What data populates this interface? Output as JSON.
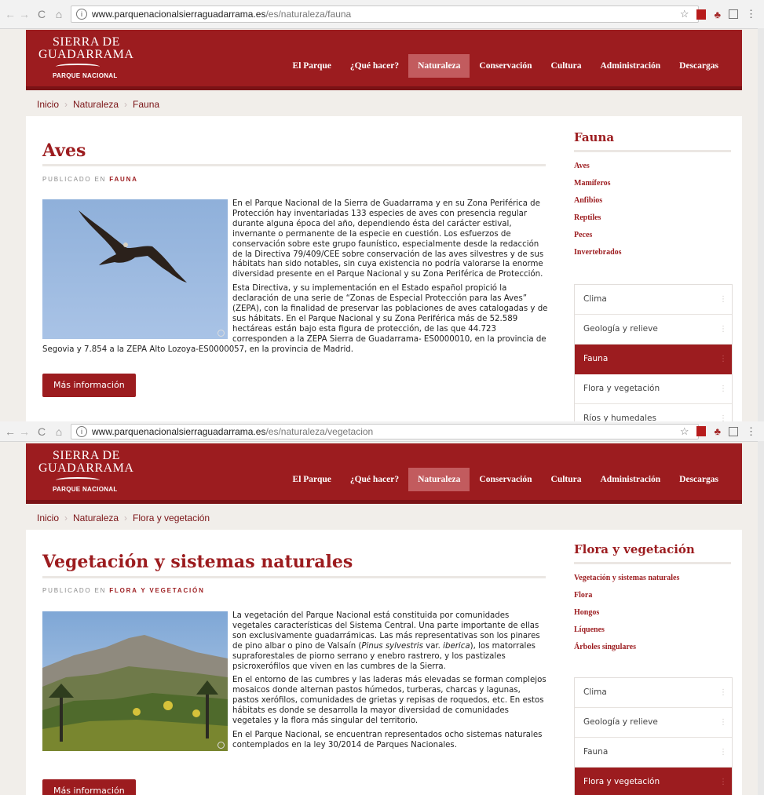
{
  "top": {
    "browser": {
      "url_domain": "www.parquenacionalsierraguadarrama.es",
      "url_path": "/es/naturaleza/fauna",
      "info_icon": "i"
    },
    "logo": {
      "line1": "SIERRA DE",
      "line2": "GUADARRAMA",
      "line3": "PARQUE NACIONAL"
    },
    "nav": [
      "El Parque",
      "¿Qué hacer?",
      "Naturaleza",
      "Conservación",
      "Cultura",
      "Administración",
      "Descargas"
    ],
    "nav_active": "Naturaleza",
    "breadcrumb": [
      "Inicio",
      "Naturaleza",
      "Fauna"
    ],
    "breadcrumb_sep": "›",
    "title": "Aves",
    "meta_prefix": "PUBLICADO EN",
    "meta_category": "FAUNA",
    "paragraphs": [
      "En el Parque Nacional de la Sierra de Guadarrama y en su Zona Periférica de Protección hay inventariadas 133 especies de aves con presencia regular durante alguna época del año, dependiendo ésta del carácter estival, invernante o permanente de la especie en cuestión. Los esfuerzos de conservación sobre este grupo faunístico, especialmente desde la redacción de la Directiva 79/409/CEE sobre conservación de las aves silvestres y de sus hábitats han sido notables, sin cuya existencia no podría valorarse la enorme diversidad presente en el Parque Nacional y su Zona Periférica de Protección.",
      "Esta Directiva, y su implementación en el Estado español propició la declaración de una serie de “Zonas de Especial Protección para las Aves” (ZEPA), con la finalidad de preservar las poblaciones de aves catalogadas y de sus hábitats. En el Parque Nacional y su Zona Periférica más de 52.589 hectáreas están bajo esta figura de protección, de las que 44.723 corresponden a la ZEPA Sierra de Guadarrama- ES0000010, en la provincia de Segovia y 7.854 a la ZEPA Alto Lozoya-ES0000057, en la provincia de Madrid."
    ],
    "more_button": "Más información",
    "sidebar_title": "Fauna",
    "sidebar_links": [
      "Aves",
      "Mamíferos",
      "Anfibios",
      "Reptiles",
      "Peces",
      "Invertebrados"
    ],
    "sidebar_menu": [
      "Clima",
      "Geología y relieve",
      "Fauna",
      "Flora y vegetación",
      "Ríos y humedales"
    ],
    "sidebar_menu_active": "Fauna"
  },
  "bottom": {
    "browser": {
      "url_domain": "www.parquenacionalsierraguadarrama.es",
      "url_path": "/es/naturaleza/vegetacion",
      "info_icon": "i"
    },
    "logo": {
      "line1": "SIERRA DE",
      "line2": "GUADARRAMA",
      "line3": "PARQUE NACIONAL"
    },
    "nav": [
      "El Parque",
      "¿Qué hacer?",
      "Naturaleza",
      "Conservación",
      "Cultura",
      "Administración",
      "Descargas"
    ],
    "nav_active": "Naturaleza",
    "breadcrumb": [
      "Inicio",
      "Naturaleza",
      "Flora y vegetación"
    ],
    "breadcrumb_sep": "›",
    "title": "Vegetación y sistemas naturales",
    "meta_prefix": "PUBLICADO EN",
    "meta_category": "FLORA Y VEGETACIÓN",
    "paragraphs_html": [
      "La vegetación del Parque Nacional está constituida por comunidades vegetales características del Sistema Central. Una parte importante de ellas son exclusivamente guadarrámicas. Las más representativas son los pinares de pino albar o pino de Valsaín (<i>Pinus sylvestris</i> var. <i>iberica</i>), los matorrales supraforestales de piorno serrano y enebro rastrero, y los pastizales psicroxerófilos que viven en las cumbres de la Sierra.",
      "En el entorno de las cumbres y las laderas más elevadas se forman complejos mosaicos donde alternan pastos húmedos, turberas, charcas y lagunas, pastos xerófilos, comunidades de grietas y repisas de roquedos, etc. En estos hábitats es donde se desarrolla la mayor diversidad de comunidades vegetales y la flora más singular del territorio.",
      "En el Parque Nacional, se encuentran representados ocho sistemas naturales contemplados en la ley 30/2014 de Parques Nacionales."
    ],
    "more_button": "Más información",
    "sidebar_title": "Flora y vegetación",
    "sidebar_links": [
      "Vegetación y sistemas naturales",
      "Flora",
      "Hongos",
      "Líquenes",
      "Árboles singulares"
    ],
    "sidebar_menu": [
      "Clima",
      "Geología y relieve",
      "Fauna",
      "Flora y vegetación"
    ],
    "sidebar_menu_active": "Flora y vegetación"
  },
  "colors": {
    "brand": "#9c1c1f",
    "brand_dark": "#7a1316",
    "nav_active": "#c25b5e",
    "page_bg": "#f1eeea"
  },
  "icons": {
    "back": "←",
    "forward": "→",
    "reload": "C",
    "home": "⌂",
    "star": "☆",
    "menu": "⋮"
  }
}
